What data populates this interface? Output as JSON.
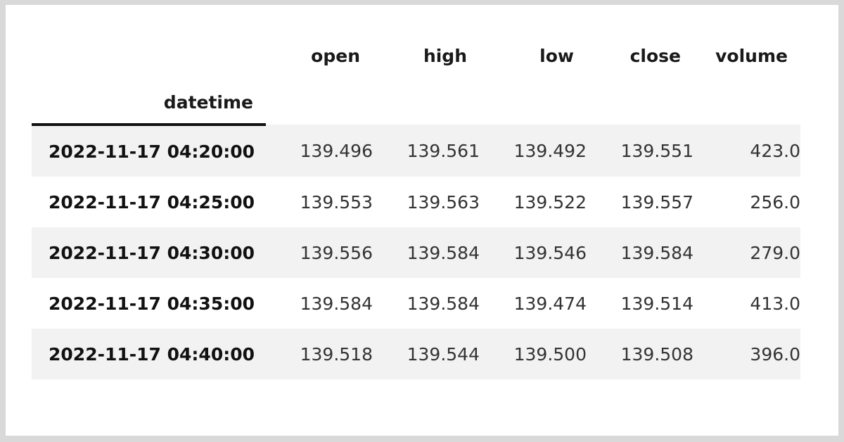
{
  "table": {
    "index_name": "datetime",
    "columns": [
      "open",
      "high",
      "low",
      "close",
      "volume"
    ],
    "rows": [
      {
        "datetime": "2022-11-17 04:20:00",
        "open": "139.496",
        "high": "139.561",
        "low": "139.492",
        "close": "139.551",
        "volume": "423.0"
      },
      {
        "datetime": "2022-11-17 04:25:00",
        "open": "139.553",
        "high": "139.563",
        "low": "139.522",
        "close": "139.557",
        "volume": "256.0"
      },
      {
        "datetime": "2022-11-17 04:30:00",
        "open": "139.556",
        "high": "139.584",
        "low": "139.546",
        "close": "139.584",
        "volume": "279.0"
      },
      {
        "datetime": "2022-11-17 04:35:00",
        "open": "139.584",
        "high": "139.584",
        "low": "139.474",
        "close": "139.514",
        "volume": "413.0"
      },
      {
        "datetime": "2022-11-17 04:40:00",
        "open": "139.518",
        "high": "139.544",
        "low": "139.500",
        "close": "139.508",
        "volume": "396.0"
      }
    ]
  },
  "colors": {
    "page_background": "#d9d9d9",
    "canvas": "#ffffff",
    "stripe": "#f2f2f2",
    "header_rule": "#111111",
    "index_text": "#111111",
    "value_text": "#333333"
  }
}
